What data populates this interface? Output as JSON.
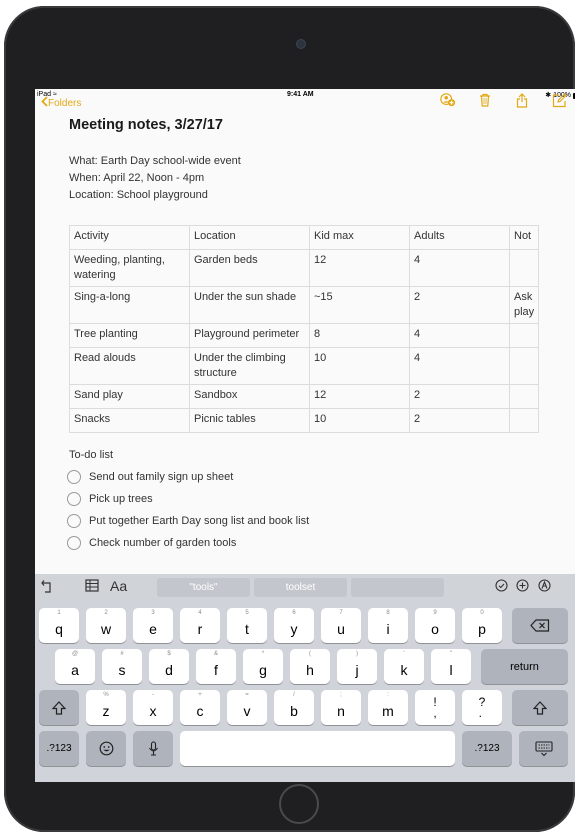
{
  "status_bar": {
    "device": "iPad",
    "time": "9:41 AM",
    "battery": "100%"
  },
  "nav": {
    "back_label": "Folders"
  },
  "icons": {
    "back": "chevron-left-icon",
    "add_people": "add-people-icon",
    "trash": "trash-icon",
    "share": "share-icon",
    "compose": "compose-icon"
  },
  "colors": {
    "accent": "#e3a914"
  },
  "note": {
    "title": "Meeting notes, 3/27/17",
    "meta": [
      "What: Earth Day school-wide event",
      "When: April 22, Noon - 4pm",
      "Location: School playground"
    ],
    "table": {
      "headers": [
        "Activity",
        "Location",
        "Kid max",
        "Adults",
        "Not"
      ],
      "rows": [
        [
          "Weeding, planting, watering",
          "Garden beds",
          "12",
          "4",
          ""
        ],
        [
          "Sing-a-long",
          "Under the sun shade",
          "~15",
          "2",
          "Ask play"
        ],
        [
          "Tree planting",
          "Playground perimeter",
          "8",
          "4",
          ""
        ],
        [
          "Read alouds",
          "Under the climbing structure",
          "10",
          "4",
          ""
        ],
        [
          "Sand play",
          "Sandbox",
          "12",
          "2",
          ""
        ],
        [
          "Snacks",
          "Picnic tables",
          "10",
          "2",
          ""
        ]
      ]
    },
    "todo_title": "To-do list",
    "todos": [
      "Send out family sign up sheet",
      "Pick up trees",
      "Put together Earth Day song list and book list",
      "Check number of garden tools"
    ]
  },
  "keyboard": {
    "toolbar": {
      "format_label": "Aa",
      "suggestions": [
        "\"tools\"",
        "toolset",
        ""
      ]
    },
    "row1": [
      {
        "k": "q",
        "h": "1"
      },
      {
        "k": "w",
        "h": "2"
      },
      {
        "k": "e",
        "h": "3"
      },
      {
        "k": "r",
        "h": "4"
      },
      {
        "k": "t",
        "h": "5"
      },
      {
        "k": "y",
        "h": "6"
      },
      {
        "k": "u",
        "h": "7"
      },
      {
        "k": "i",
        "h": "8"
      },
      {
        "k": "o",
        "h": "9"
      },
      {
        "k": "p",
        "h": "0"
      }
    ],
    "row2": [
      {
        "k": "a",
        "h": "@"
      },
      {
        "k": "s",
        "h": "#"
      },
      {
        "k": "d",
        "h": "$"
      },
      {
        "k": "f",
        "h": "&"
      },
      {
        "k": "g",
        "h": "*"
      },
      {
        "k": "h",
        "h": "("
      },
      {
        "k": "j",
        "h": ")"
      },
      {
        "k": "k",
        "h": "'"
      },
      {
        "k": "l",
        "h": "\""
      }
    ],
    "row3": [
      {
        "k": "z",
        "h": "%"
      },
      {
        "k": "x",
        "h": "-"
      },
      {
        "k": "c",
        "h": "+"
      },
      {
        "k": "v",
        "h": "="
      },
      {
        "k": "b",
        "h": "/"
      },
      {
        "k": "n",
        "h": ";"
      },
      {
        "k": "m",
        "h": ":"
      },
      {
        "k": "!\n,",
        "h": ""
      },
      {
        "k": "?\n.",
        "h": ""
      }
    ],
    "return_label": "return",
    "num_label": ".?123"
  }
}
